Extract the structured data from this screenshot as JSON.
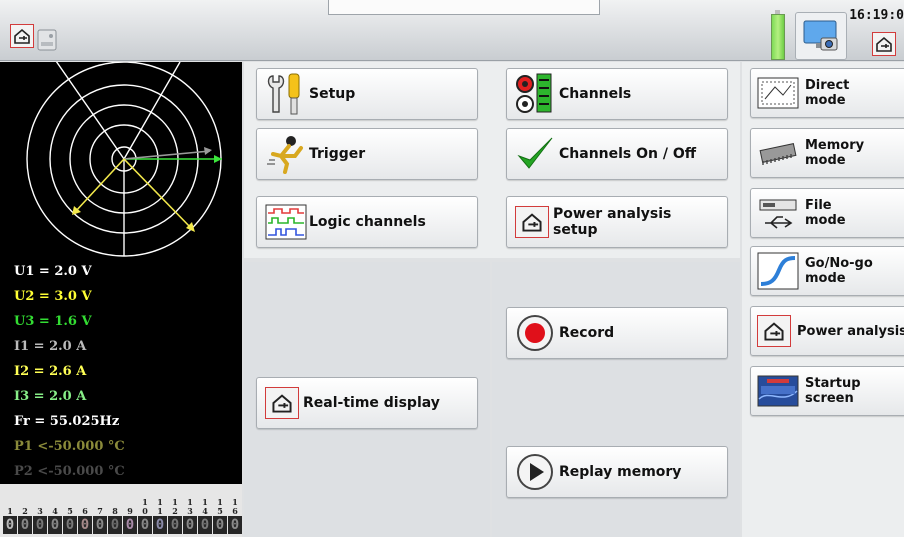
{
  "topbar": {
    "clock": "16:19:0",
    "home_icon_left": "home-plug-icon",
    "drive_icon": "hard-drive-icon",
    "battery_icon": "battery-icon",
    "monitor_icon": "monitor-camera-icon",
    "home_icon_right": "home-plug-icon"
  },
  "readings": [
    {
      "text": "U1 =  2.0  V",
      "color": "#ffffff"
    },
    {
      "text": "U2 =  3.0  V",
      "color": "#ffff33"
    },
    {
      "text": "U3 =  1.6  V",
      "color": "#33dd33"
    },
    {
      "text": "I1 =  2.0  A",
      "color": "#bbbbbb"
    },
    {
      "text": "I2 =  2.6  A",
      "color": "#ffff55"
    },
    {
      "text": "I3 =  2.0  A",
      "color": "#88ee88"
    },
    {
      "text": "Fr = 55.025Hz",
      "color": "#ffffff"
    },
    {
      "text": "P1 <-50.000 °C",
      "color": "#8a8a3a"
    },
    {
      "text": "P2 <-50.000 °C",
      "color": "#4a4a4a"
    }
  ],
  "channel_strip": {
    "numbers": [
      "1",
      "2",
      "3",
      "4",
      "5",
      "6",
      "7",
      "8",
      "9",
      "10",
      "11",
      "12",
      "13",
      "14",
      "15",
      "16"
    ],
    "states": [
      "0",
      "0",
      "0",
      "0",
      "0",
      "0",
      "0",
      "0",
      "0",
      "0",
      "0",
      "0",
      "0",
      "0",
      "0",
      "0"
    ]
  },
  "menu": {
    "setup": "Setup",
    "trigger": "Trigger",
    "logic_channels": "Logic channels",
    "channels": "Channels",
    "channels_on_off": "Channels On / Off",
    "power_analysis_setup_1": "Power analysis",
    "power_analysis_setup_2": "setup",
    "real_time_display": "Real-time display",
    "record": "Record",
    "replay_memory": "Replay memory"
  },
  "modes": {
    "direct_1": "Direct",
    "direct_2": "mode",
    "memory_1": "Memory",
    "memory_2": "mode",
    "file_1": "File",
    "file_2": "mode",
    "gonogo_1": "Go/No-go",
    "gonogo_2": "mode",
    "power_analysis": "Power analysis",
    "startup_1": "Startup",
    "startup_2": "screen"
  },
  "colors": {
    "accent_red": "#d23b3b",
    "record_red": "#e0101a",
    "phasor_white": "#ffffff",
    "phasor_yellow": "#f2e84b",
    "phasor_green": "#3ce63c",
    "phasor_gray": "#9a9a9a"
  }
}
